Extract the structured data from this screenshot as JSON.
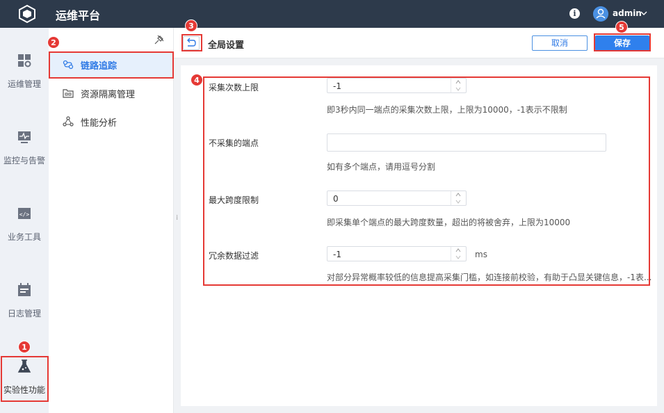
{
  "app": {
    "title": "运维平台"
  },
  "header": {
    "user_name": "admin"
  },
  "nav": {
    "items": [
      {
        "label": "运维管理"
      },
      {
        "label": "监控与告警"
      },
      {
        "label": "业务工具"
      },
      {
        "label": "日志管理"
      },
      {
        "label": "实验性功能"
      }
    ]
  },
  "subnav": {
    "items": [
      {
        "label": "链路追踪"
      },
      {
        "label": "资源隔离管理"
      },
      {
        "label": "性能分析"
      }
    ]
  },
  "page": {
    "title": "全局设置",
    "cancel_label": "取消",
    "save_label": "保存"
  },
  "form": {
    "fields": [
      {
        "label": "采集次数上限",
        "value": "-1",
        "hint": "即3秒内同一端点的采集次数上限，上限为10000，-1表示不限制"
      },
      {
        "label": "不采集的端点",
        "value": "",
        "hint": "如有多个端点，请用逗号分割"
      },
      {
        "label": "最大跨度限制",
        "value": "0",
        "hint": "即采集单个端点的最大跨度数量，超出的将被舍弃，上限为10000"
      },
      {
        "label": "冗余数据过滤",
        "value": "-1",
        "unit": "ms",
        "hint": "对部分异常概率较低的信息提高采集门槛，如连接前校验，有助于凸显关键信息，-1表..."
      }
    ]
  },
  "annotations": [
    "1",
    "2",
    "3",
    "4",
    "5"
  ],
  "colors": {
    "topbar": "#2d3a4b",
    "accent": "#2f80ed",
    "annotation": "#e53935"
  }
}
